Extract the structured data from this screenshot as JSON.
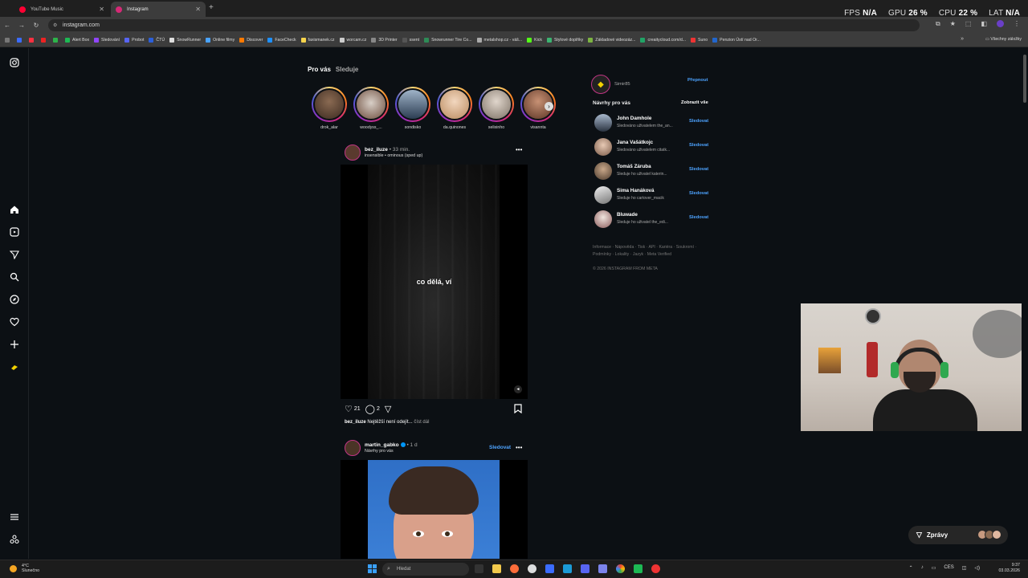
{
  "browser": {
    "tabs": [
      {
        "label": "YouTube Music",
        "color": "#ff0033"
      },
      {
        "label": "Instagram",
        "color": "#d62976"
      }
    ],
    "url": "instagram.com",
    "hud": {
      "fps_label": "FPS",
      "fps_value": "N/A",
      "gpu_label": "GPU",
      "gpu_value": "26 %",
      "cpu_label": "CPU",
      "cpu_value": "22 %",
      "lat_label": "LAT",
      "lat_value": "N/A"
    },
    "bookmarks": [
      "Alert Box",
      "Sledování",
      "Probot",
      "ČTÚ",
      "SnowRunner",
      "Online filmy",
      "Discover",
      "FaceCheck",
      "faxismanek.cz",
      "worcam.cz",
      "3D Printer",
      "ssent",
      "Snowrunner Tire Co...",
      "metalshop.cz - váš...",
      "Kick",
      "Stylové doplňky",
      "Základové videozáz...",
      "creaitycloud.com/d...",
      "Suno",
      "Penzion Ústí nad Or..."
    ],
    "all_bookmarks": "Všechny záložky"
  },
  "feed": {
    "tab_for_you": "Pro vás",
    "tab_following": "Sleduje"
  },
  "stories": [
    "drok_alar",
    "woodyss_...",
    "sondisko",
    "da.quinones",
    "selixinho",
    "visannta"
  ],
  "post1": {
    "user": "bez_iluze",
    "ago": "• 33 min.",
    "sub": "insensible • ominous (sped up)",
    "overlay": "co dělá, ví",
    "likes": "21",
    "comments": "2",
    "caption_user": "bez_iluze",
    "caption_text": "Nejtěžší není odejít...",
    "more": "číst dál"
  },
  "post2": {
    "user": "martin_gabko",
    "ago": "• 1 d",
    "sub": "Návrhy pro vás",
    "follow": "Sledovat"
  },
  "sidebar": {
    "me_name": "Simir85",
    "switch": "Přepnout",
    "suggestions_title": "Návrhy pro vás",
    "see_all": "Zobrazit vše",
    "suggestions": [
      {
        "name": "John Damhole",
        "sub": "Sledováno uživatelem the_an...",
        "follow": "Sledovat"
      },
      {
        "name": "Jana Vašátkojc",
        "sub": "Sledováno uživatelem citatk...",
        "follow": "Sledovat"
      },
      {
        "name": "Tomáš Záruba",
        "sub": "Sleduje ho uživatel katerin...",
        "follow": "Sledovat"
      },
      {
        "name": "Sima Hanáková",
        "sub": "Sleduje ho cartover_macik",
        "follow": "Sledovat"
      },
      {
        "name": "Bluwade",
        "sub": "Sleduje ho uživatel the_edi...",
        "follow": "Sledovat"
      }
    ],
    "footer_links": "Informace · Nápověda · Tisk · API · Kariéra · Soukromí · Podmínky · Lokality · Jazyk · Meta Verified",
    "copyright": "© 2026 INSTAGRAM FROM META"
  },
  "messages": {
    "label": "Zprávy"
  },
  "taskbar": {
    "temp": "4°C",
    "weather": "Slunečno",
    "search_placeholder": "Hledat",
    "lang": "CES",
    "time": "9:37",
    "date": "03.03.2026"
  }
}
